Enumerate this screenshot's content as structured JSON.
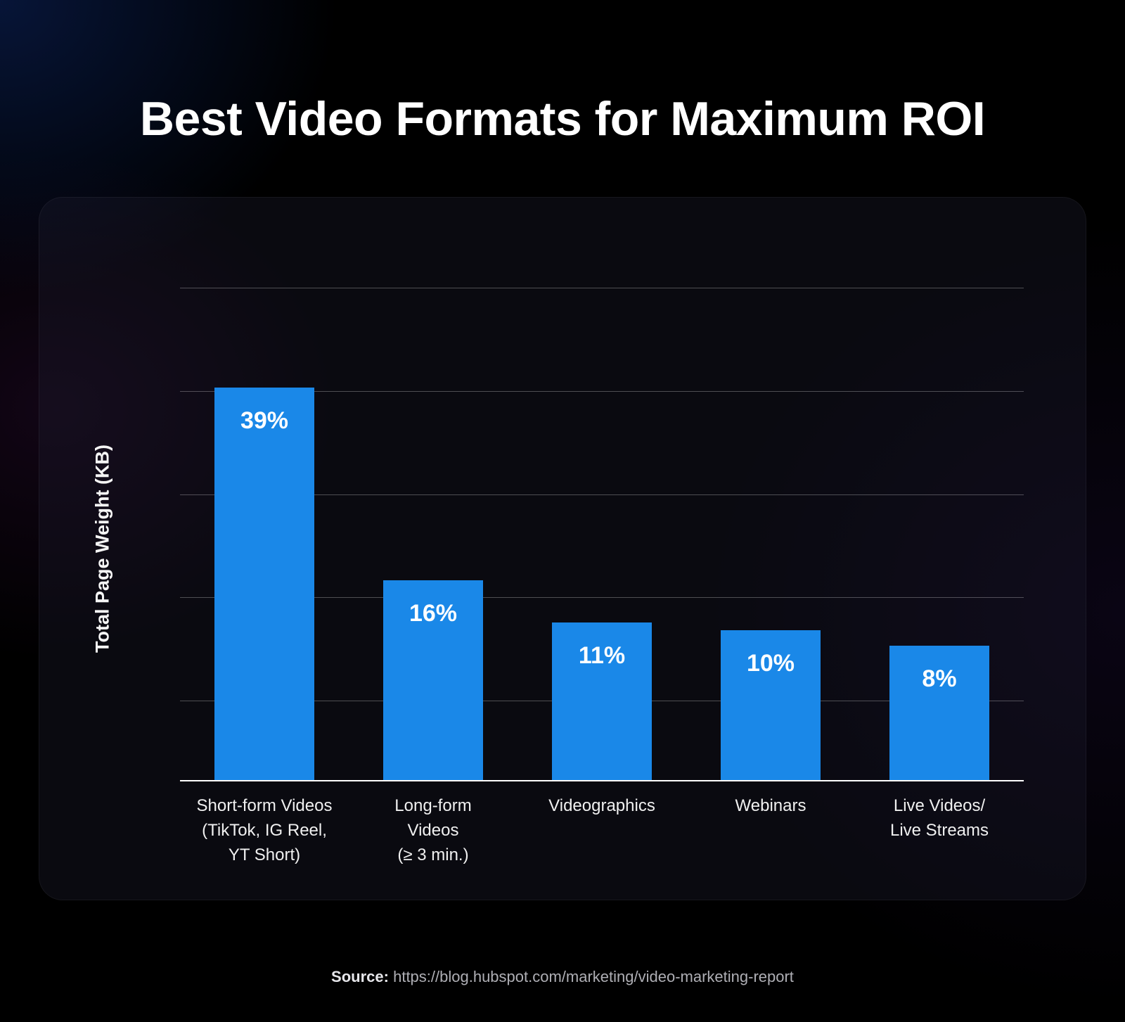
{
  "title": "Best Video Formats for Maximum ROI",
  "ylabel": "Total Page Weight (KB)",
  "source": {
    "label": "Source:",
    "url": "https://blog.hubspot.com/marketing/video-marketing-report"
  },
  "chart_data": {
    "type": "bar",
    "title": "Best Video Formats for Maximum ROI",
    "ylabel": "Total Page Weight (KB)",
    "xlabel": "",
    "ylim": [
      0,
      45
    ],
    "grid": true,
    "categories": [
      "Short-form Videos\n(TikTok, IG Reel,\nYT Short)",
      "Long-form\nVideos\n(≥ 3 min.)",
      "Videographics",
      "Webinars",
      "Live Videos/\nLive Streams"
    ],
    "values": [
      39,
      16,
      11,
      10,
      8
    ],
    "value_labels": [
      "39%",
      "16%",
      "11%",
      "10%",
      "8%"
    ],
    "bar_color": "#1a88e8"
  }
}
